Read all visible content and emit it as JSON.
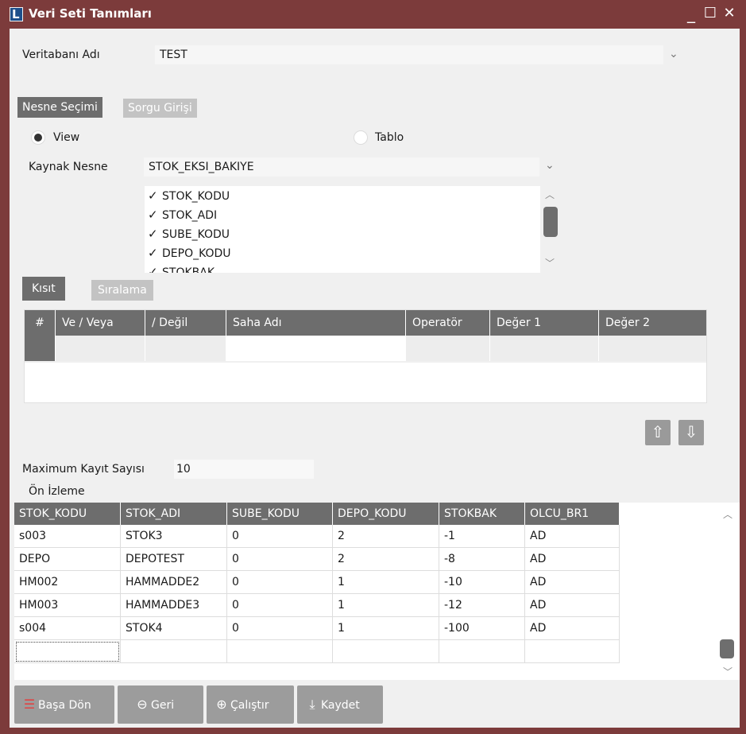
{
  "window": {
    "title": "Veri Seti Tanımları",
    "app_logo_letter": "L",
    "minimize": "_",
    "maximize": "☐",
    "close": "✕"
  },
  "database": {
    "label": "Veritabanı Adı",
    "value": "TEST"
  },
  "tabs": [
    {
      "label": "Nesne Seçimi",
      "active": true
    },
    {
      "label": "Sorgu Girişi",
      "active": false
    }
  ],
  "object_type": {
    "view_label": "View",
    "table_label": "Tablo",
    "selected": "View"
  },
  "source": {
    "label": "Kaynak Nesne",
    "value": "STOK_EKSI_BAKIYE"
  },
  "fields": [
    {
      "name": "STOK_KODU",
      "checked": true
    },
    {
      "name": "STOK_ADI",
      "checked": true
    },
    {
      "name": "SUBE_KODU",
      "checked": true
    },
    {
      "name": "DEPO_KODU",
      "checked": true
    },
    {
      "name": "STOKBAK",
      "checked": true
    }
  ],
  "sub_tabs": [
    {
      "label": "Kısıt",
      "active": true
    },
    {
      "label": "Sıralama",
      "active": false
    }
  ],
  "constraint_grid": {
    "columns": [
      "#",
      "Ve / Veya",
      "/ Değil",
      "Saha Adı",
      "Operatör",
      "Değer 1",
      "Değer 2"
    ]
  },
  "max_records": {
    "label": "Maximum Kayıt Sayısı",
    "value": "10"
  },
  "preview": {
    "label": "Ön İzleme",
    "columns": [
      "STOK_KODU",
      "STOK_ADI",
      "SUBE_KODU",
      "DEPO_KODU",
      "STOKBAK",
      "OLCU_BR1"
    ],
    "rows": [
      [
        "s003",
        "STOK3",
        "0",
        "2",
        "-1",
        "AD"
      ],
      [
        "DEPO",
        "DEPOTEST",
        "0",
        "2",
        "-8",
        "AD"
      ],
      [
        "HM002",
        "HAMMADDE2",
        "0",
        "1",
        "-10",
        "AD"
      ],
      [
        "HM003",
        "HAMMADDE3",
        "0",
        "1",
        "-12",
        "AD"
      ],
      [
        "s004",
        "STOK4",
        "0",
        "1",
        "-100",
        "AD"
      ]
    ]
  },
  "buttons": {
    "home": "Başa Dön",
    "back": "Geri",
    "run": "Çalıştır",
    "save": "Kaydet"
  }
}
